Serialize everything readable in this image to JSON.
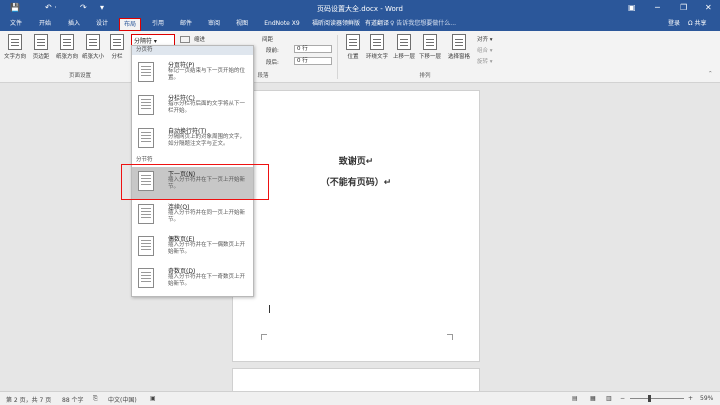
{
  "titlebar": {
    "doc_title": "页码设置大全.docx - Word",
    "quick": [
      "💾",
      "↶ ·",
      "↷",
      "▾"
    ]
  },
  "tabs": [
    "文件",
    "开始",
    "插入",
    "设计",
    "布局",
    "引用",
    "邮件",
    "审阅",
    "视图",
    "EndNote X9",
    "福昕阅读器领鲜版",
    "有道翻译"
  ],
  "tellme": "♀ 告诉我您想要做什么...",
  "account": {
    "login": "登录",
    "share": "Ω 共享"
  },
  "ribbon": {
    "buttons": [
      "文字方向",
      "页边距",
      "纸张方向",
      "纸张大小",
      "分栏"
    ],
    "breaks_btn": "分隔符 ▾",
    "line_numbers_label": "",
    "hyphen_label": "",
    "indent_label": "缩进",
    "spacing_label": "间距",
    "before_label": "段前:",
    "after_label": "段后:",
    "before_val": "0 行",
    "after_val": "0 行",
    "group_page_setup": "页面设置",
    "group_paragraph": "段落",
    "group_arrange": "排列",
    "arrange_buttons": [
      "位置",
      "环绕文字",
      "上移一层",
      "下移一层",
      "选择窗格"
    ],
    "align": "对齐 ▾",
    "group": "组合 ▾",
    "rotate": "旋转 ▾"
  },
  "dropdown": {
    "head_page": "分页符",
    "head_section": "分节符",
    "items": [
      {
        "title": "分页符(P)",
        "desc": "标记一页结束与下一页开始的位置。"
      },
      {
        "title": "分栏符(C)",
        "desc": "指示分栏符后面的文字将从下一栏开始。"
      },
      {
        "title": "自动换行符(T)",
        "desc": "分隔网页上的对象周围的文字，如分隔题注文字与正文。"
      },
      {
        "title": "下一页(N)",
        "desc": "插入分节符并在下一页上开始新节。"
      },
      {
        "title": "连续(O)",
        "desc": "插入分节符并在同一页上开始新节。"
      },
      {
        "title": "偶数页(E)",
        "desc": "插入分节符并在下一偶数页上开始新节。"
      },
      {
        "title": "奇数页(D)",
        "desc": "插入分节符并在下一奇数页上开始新节。"
      }
    ]
  },
  "doc": {
    "line1": "致谢页↵",
    "line2": "（不能有页码）↵"
  },
  "status": {
    "page": "第 2 页，共 7 页",
    "words": "88 个字",
    "lang": "中文(中国)",
    "zoom": "59%"
  },
  "colors": {
    "brand": "#2b579a",
    "highlight": "#e11"
  }
}
